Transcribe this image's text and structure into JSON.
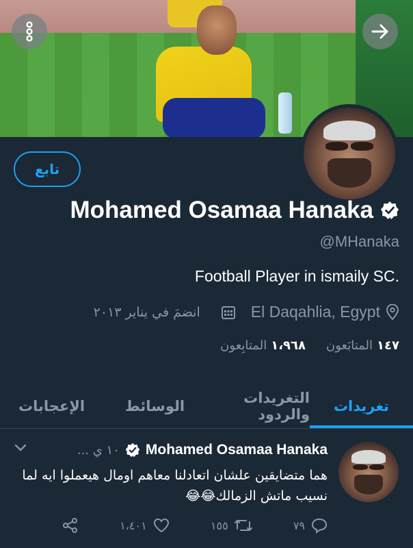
{
  "profile": {
    "follow_label": "تابع",
    "name": "Mohamed Osamaa Hanaka",
    "handle": "@MHanaka",
    "bio": "Football Player in ismaily SC.",
    "location": "El Daqahlia, Egypt",
    "joined": "انضمَ في يناير ٢٠١٣",
    "following_count": "١٤٧",
    "following_label": "المتابَعون",
    "followers_count": "١،٩٦٨",
    "followers_label": "المتابِعون"
  },
  "icons": {
    "more": "more-vertical-icon",
    "forward": "arrow-right-icon",
    "verified": "verified-badge-icon",
    "calendar": "calendar-icon",
    "location": "location-pin-icon",
    "caret": "chevron-down-icon",
    "reply": "reply-icon",
    "retweet": "retweet-icon",
    "like": "heart-icon",
    "share": "share-icon"
  },
  "tabs": [
    {
      "label": "تغريدات",
      "active": true
    },
    {
      "label": "التغريدات والردود",
      "active": false
    },
    {
      "label": "الوسائط",
      "active": false
    },
    {
      "label": "الإعجابات",
      "active": false
    }
  ],
  "tweet": {
    "name": "Mohamed Osamaa Hanaka",
    "time": "١٠ ي ...",
    "text": "هما متضايقين علشان اتعادلنا معاهم اومال هيعملوا ايه لما نسيب ماتش الزمالك😂😂",
    "replies": "٧٩",
    "retweets": "١٥٥",
    "likes": "١،٤٠١"
  },
  "colors": {
    "background": "#1b2836",
    "accent": "#1da1f2",
    "muted": "#8899a6",
    "divider": "#38444d"
  }
}
